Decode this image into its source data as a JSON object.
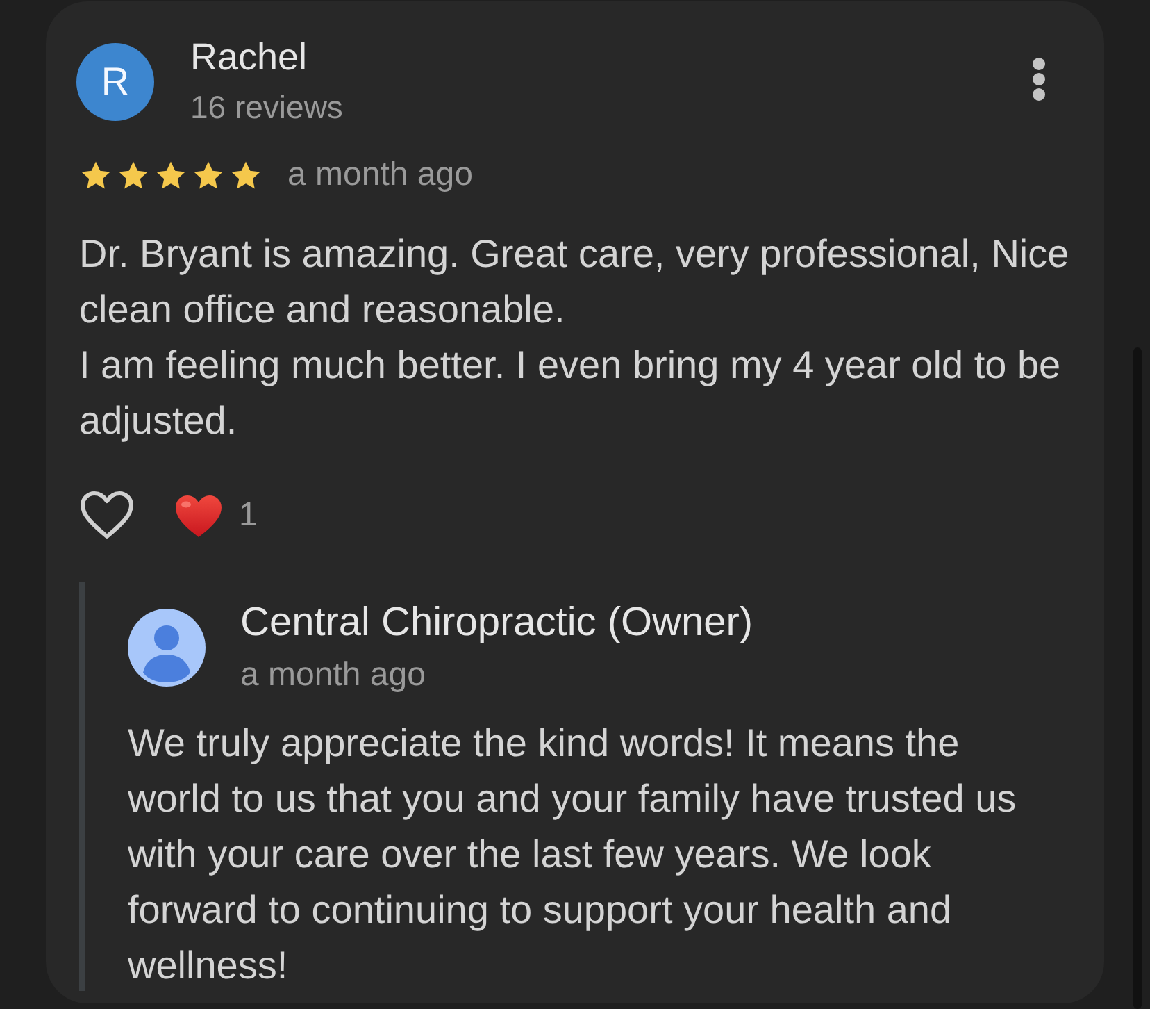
{
  "review": {
    "author": {
      "initial": "R",
      "name": "Rachel",
      "review_count": "16 reviews"
    },
    "stars": 5,
    "time": "a month ago",
    "paragraphs": [
      "Dr. Bryant is amazing. Great care, very professional, Nice clean office and reasonable.",
      "I am feeling much better. I even bring my 4 year old to be adjusted."
    ],
    "liked": false,
    "reaction_count": "1"
  },
  "reply": {
    "name": "Central Chiropractic (Owner)",
    "time": "a month ago",
    "text": "We truly appreciate the kind words! It means the world to us that you and your family have trusted us with your care over the last few years. We look forward to continuing to support your health and wellness!"
  }
}
